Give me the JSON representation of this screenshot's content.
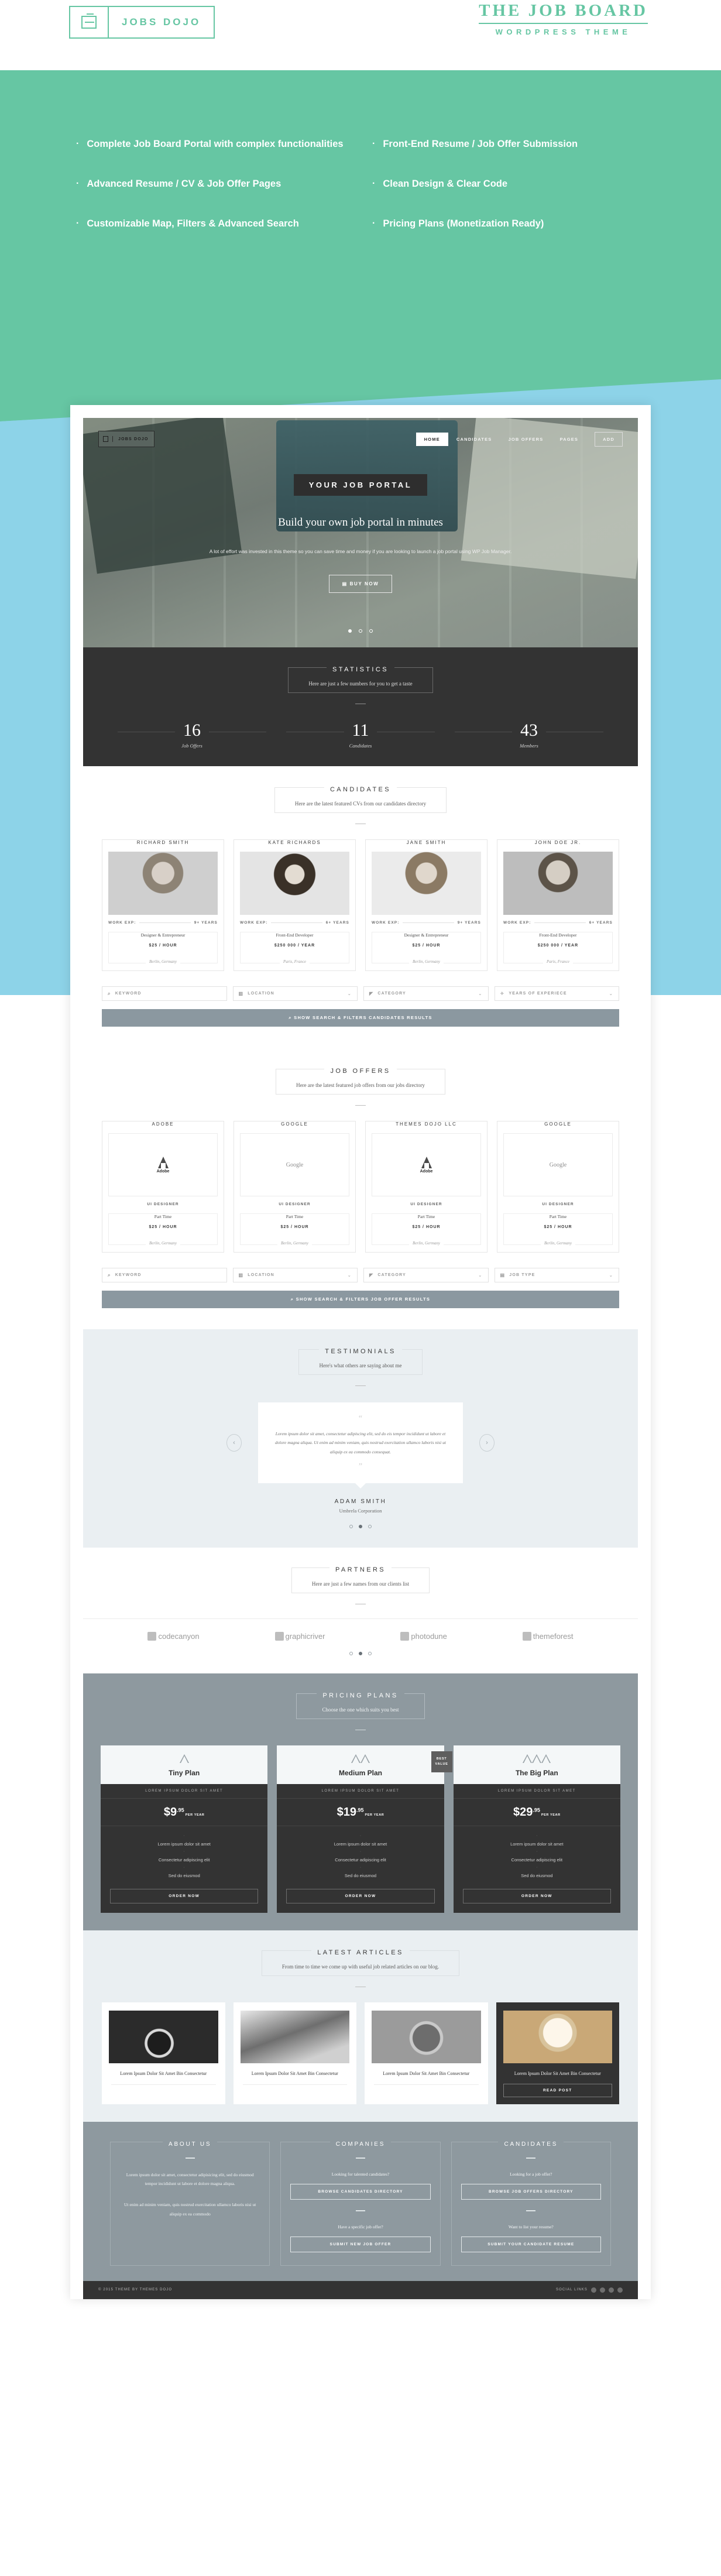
{
  "header": {
    "logo_text": "JOBS DOJO",
    "logo_icon": "briefcase-icon",
    "brand_title": "THE JOB BOARD",
    "brand_subtitle": "WORDPRESS THEME"
  },
  "features": {
    "bullet": "·",
    "left": [
      "Complete Job Board Portal with complex functionalities",
      "Advanced Resume / CV & Job Offer Pages",
      "Customizable Map, Filters & Advanced Search"
    ],
    "right": [
      "Front-End Resume / Job Offer Submission",
      "Clean Design & Clear Code",
      "Pricing Plans (Monetization Ready)"
    ]
  },
  "mockup": {
    "nav": {
      "logo_text": "JOBS DOJO",
      "items": [
        "HOME",
        "CANDIDATES",
        "JOB OFFERS",
        "PAGES"
      ],
      "add_label": "ADD"
    },
    "hero": {
      "badge": "YOUR JOB PORTAL",
      "heading": "Build your own job portal in minutes",
      "paragraph": "A lot of effort was invested in this theme so you can save time and money if you are looking to launch a job portal using WP Job Manager.",
      "cta": "BUY NOW",
      "cta_icon": "card-icon"
    },
    "statistics": {
      "title": "STATISTICS",
      "subtitle": "Here are just a few numbers for you to get a taste",
      "items": [
        {
          "value": "16",
          "label": "Job Offers"
        },
        {
          "value": "11",
          "label": "Candidates"
        },
        {
          "value": "43",
          "label": "Members"
        }
      ]
    },
    "candidates": {
      "title": "CANDIDATES",
      "subtitle": "Here are the latest featured CVs from our candidates directory",
      "exp_label": "WORK EXP:",
      "cards": [
        {
          "name": "RICHARD SMITH",
          "exp": "9+ YEARS",
          "role": "Designer & Entrepreneur",
          "pay": "$25 / HOUR",
          "loc": "Berlin, Germany"
        },
        {
          "name": "KATE RICHARDS",
          "exp": "6+ YEARS",
          "role": "Front-End Developer",
          "pay": "$250 000 / YEAR",
          "loc": "Paris, France"
        },
        {
          "name": "JANE SMITH",
          "exp": "9+ YEARS",
          "role": "Designer & Entrepreneur",
          "pay": "$25 / HOUR",
          "loc": "Berlin, Germany"
        },
        {
          "name": "JOHN DOE JR.",
          "exp": "6+ YEARS",
          "role": "Front-End Developer",
          "pay": "$250 000 / YEAR",
          "loc": "Paris, France"
        }
      ],
      "filters": [
        {
          "label": "KEYWORD",
          "icon": "search-icon",
          "caret": false
        },
        {
          "label": "LOCATION",
          "icon": "map-icon",
          "caret": true
        },
        {
          "label": "CATEGORY",
          "icon": "tag-icon",
          "caret": true
        },
        {
          "label": "YEARS OF EXPERIECE",
          "icon": "badge-icon",
          "caret": true
        }
      ],
      "button": "SHOW SEARCH & FILTERS CANDIDATES RESULTS",
      "button_icon": "search-icon"
    },
    "job_offers": {
      "title": "JOB OFFERS",
      "subtitle": "Here are the latest featured job offers from our jobs directory",
      "cards": [
        {
          "company": "ADOBE",
          "logo": "adobe-logo",
          "title": "UI DESIGNER",
          "type": "Part Time",
          "pay": "$25 / HOUR",
          "loc": "Berlin, Germany"
        },
        {
          "company": "GOOGLE",
          "logo": "google-logo",
          "title": "UI DESIGNER",
          "type": "Part Time",
          "pay": "$25 / HOUR",
          "loc": "Berlin, Germany"
        },
        {
          "company": "THEMES DOJO LLC",
          "logo": "adobe-logo",
          "title": "UI DESIGNER",
          "type": "Part Time",
          "pay": "$25 / HOUR",
          "loc": "Berlin, Germany"
        },
        {
          "company": "GOOGLE",
          "logo": "google-logo",
          "title": "UI DESIGNER",
          "type": "Part Time",
          "pay": "$25 / HOUR",
          "loc": "Berlin, Germany"
        }
      ],
      "filters": [
        {
          "label": "KEYWORD",
          "icon": "search-icon",
          "caret": false
        },
        {
          "label": "LOCATION",
          "icon": "map-icon",
          "caret": true
        },
        {
          "label": "CATEGORY",
          "icon": "tag-icon",
          "caret": true
        },
        {
          "label": "JOB TYPE",
          "icon": "briefcase-icon",
          "caret": true
        }
      ],
      "button": "SHOW SEARCH & FILTERS JOB OFFER RESULTS",
      "button_icon": "search-icon"
    },
    "testimonials": {
      "title": "TESTIMONIALS",
      "subtitle": "Here's what others are saying about me",
      "quote": "Lorem ipsum dolor sit amet, consectetur adipiscing elit, sed do eis tempor incididunt ut labore et dolore magna aliqua. Ut enim ad minim veniam, quis nostrud exercitation ullamco laboris nisi ut aliquip ex ea commodo consequat.",
      "author": "ADAM SMITH",
      "company": "Umbrela Corporation",
      "prev_icon": "chevron-left-icon",
      "next_icon": "chevron-right-icon"
    },
    "partners": {
      "title": "PARTNERS",
      "subtitle": "Here are just a few names from our clients list",
      "logos": [
        "codecanyon",
        "graphicriver",
        "photodune",
        "themeforest"
      ]
    },
    "pricing": {
      "title": "PRICING PLANS",
      "subtitle": "Choose the one which suits you best",
      "badge": "BEST VALUE",
      "tagline": "LOREM IPSUM DOLOR SIT AMET",
      "per": "PER YEAR",
      "order_label": "ORDER NOW",
      "features": [
        "Lorem ipsum dolor sit amet",
        "Consectetur adipiscing elit",
        "Sed do eiusmod"
      ],
      "plans": [
        {
          "name": "Tiny Plan",
          "dollars": "$9",
          "cents": ".95",
          "peaks": 1
        },
        {
          "name": "Medium Plan",
          "dollars": "$19",
          "cents": ".95",
          "peaks": 2
        },
        {
          "name": "The Big Plan",
          "dollars": "$29",
          "cents": ".95",
          "peaks": 3
        }
      ]
    },
    "articles": {
      "title": "LATEST ARTICLES",
      "subtitle": "From time to time we come up with useful job related articles on our blog.",
      "read_label": "READ POST",
      "items": [
        {
          "title": "Lorem Ipsum Dolor Sit Amet Bin Consectetur"
        },
        {
          "title": "Lorem Ipsum Dolor Sit Amet Bin Consectetur"
        },
        {
          "title": "Lorem Ipsum Dolor Sit Amet Bin Consectetur"
        },
        {
          "title": "Lorem Ipsum Dolor Sit Amet Bin Consectetur"
        }
      ]
    },
    "footer": {
      "about": {
        "title": "ABOUT US",
        "p1": "Lorem ipsum dolor sit amet, consectetur adipisicing elit, sed do eiusmod tempor incididunt ut labore et dolore magna aliqua.",
        "p2": "Ut enim ad minim veniam, quis nostrud exercitation ullamco laboris nisi ut aliquip ex ea commodo"
      },
      "companies": {
        "title": "COMPANIES",
        "q1": "Looking for talented candidates?",
        "b1": "BROWSE CANDIDATES DIRECTORY",
        "q2": "Have a specific job offer?",
        "b2": "SUBMIT NEW JOB OFFER"
      },
      "candidates": {
        "title": "CANDIDATES",
        "q1": "Looking for a job offer?",
        "b1": "BROWSE JOB OFFERS DIRECTORY",
        "q2": "Want to list your resume?",
        "b2": "SUBMIT YOUR CANDIDATE RESUME"
      },
      "bar_left": "© 2015 THEME BY THEMES DOJO",
      "bar_right": "SOCIAL LINKS"
    }
  },
  "colors": {
    "brand_green": "#66c6a3",
    "sky_blue": "#8dd3e8",
    "dark": "#333333",
    "slate": "#8e999f",
    "pale": "#eaeff2"
  }
}
